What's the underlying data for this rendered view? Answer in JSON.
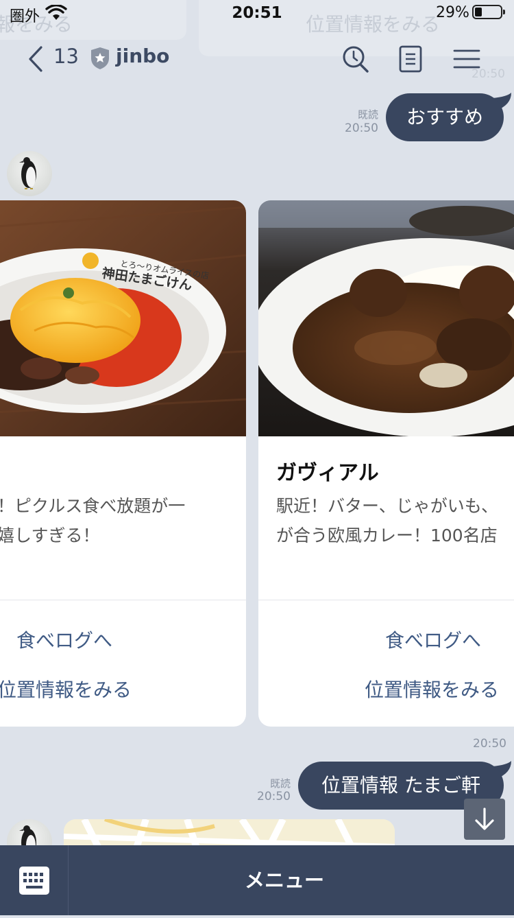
{
  "status": {
    "carrier": "圏外",
    "time": "20:51",
    "battery": "29%"
  },
  "ghost": {
    "left": "報をみる",
    "right": "位置情報をみる",
    "time": "20:50"
  },
  "header": {
    "back_count": "13",
    "room_name": "jinbo"
  },
  "messages": {
    "first": {
      "read": "既読",
      "time": "20:50",
      "text": "おすすめ"
    },
    "carousel_time": "20:50",
    "second": {
      "read": "既読",
      "time": "20:50",
      "text": "位置情報 たまご軒"
    }
  },
  "cards": [
    {
      "photo_text_small": "とろ〜りオムライスの店",
      "photo_text_big": "神田たまごけん",
      "desc1": "！ピクルス食べ放題が一",
      "desc2": "嬉しすぎる！",
      "action1": "食べログへ",
      "action2": "位置情報をみる"
    },
    {
      "title": "ガヴィアル",
      "desc1": "駅近！バター、じゃがいも、",
      "desc2": "が合う欧風カレー！100名店",
      "action1": "食べログへ",
      "action2": "位置情報をみる"
    }
  ],
  "bottom": {
    "menu_label": "メニュー"
  }
}
